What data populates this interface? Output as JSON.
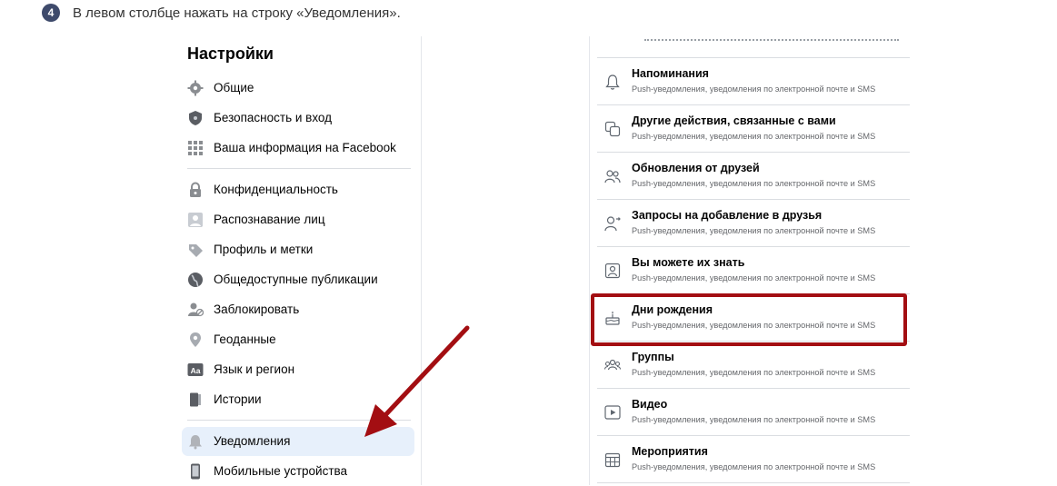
{
  "instruction": {
    "step_number": "4",
    "text": "В левом столбце нажать на строку «Уведомления»."
  },
  "settings": {
    "title": "Настройки",
    "items": [
      {
        "label": "Общие",
        "icon": "gear-icon"
      },
      {
        "label": "Безопасность и вход",
        "icon": "shield-icon"
      },
      {
        "label": "Ваша информация на Facebook",
        "icon": "grid-icon"
      },
      {
        "label": "Конфиденциальность",
        "icon": "lock-icon"
      },
      {
        "label": "Распознавание лиц",
        "icon": "face-icon"
      },
      {
        "label": "Профиль и метки",
        "icon": "tag-icon"
      },
      {
        "label": "Общедоступные публикации",
        "icon": "globe-icon"
      },
      {
        "label": "Заблокировать",
        "icon": "block-user-icon"
      },
      {
        "label": "Геоданные",
        "icon": "location-icon"
      },
      {
        "label": "Язык и регион",
        "icon": "language-icon"
      },
      {
        "label": "Истории",
        "icon": "book-icon"
      },
      {
        "label": "Уведомления",
        "icon": "bell-icon",
        "active": true
      },
      {
        "label": "Мобильные устройства",
        "icon": "phone-icon"
      }
    ]
  },
  "notifications": {
    "subtitle": "Push-уведомления, уведомления по электронной почте и SMS",
    "items": [
      {
        "title": "Напоминания",
        "icon": "bell-outline-icon"
      },
      {
        "title": "Другие действия, связанные с вами",
        "icon": "overlap-squares-icon"
      },
      {
        "title": "Обновления от друзей",
        "icon": "friends-icon"
      },
      {
        "title": "Запросы на добавление в друзья",
        "icon": "add-friend-icon"
      },
      {
        "title": "Вы можете их знать",
        "icon": "contacts-icon"
      },
      {
        "title": "Дни рождения",
        "icon": "cake-icon",
        "highlighted": true
      },
      {
        "title": "Группы",
        "icon": "group-icon"
      },
      {
        "title": "Видео",
        "icon": "video-play-icon"
      },
      {
        "title": "Мероприятия",
        "icon": "calendar-icon"
      }
    ]
  },
  "colors": {
    "highlight": "#a30e12",
    "arrow": "#a30e12",
    "active_bg": "#e7f0fb",
    "step_badge": "#3e4a6b"
  }
}
